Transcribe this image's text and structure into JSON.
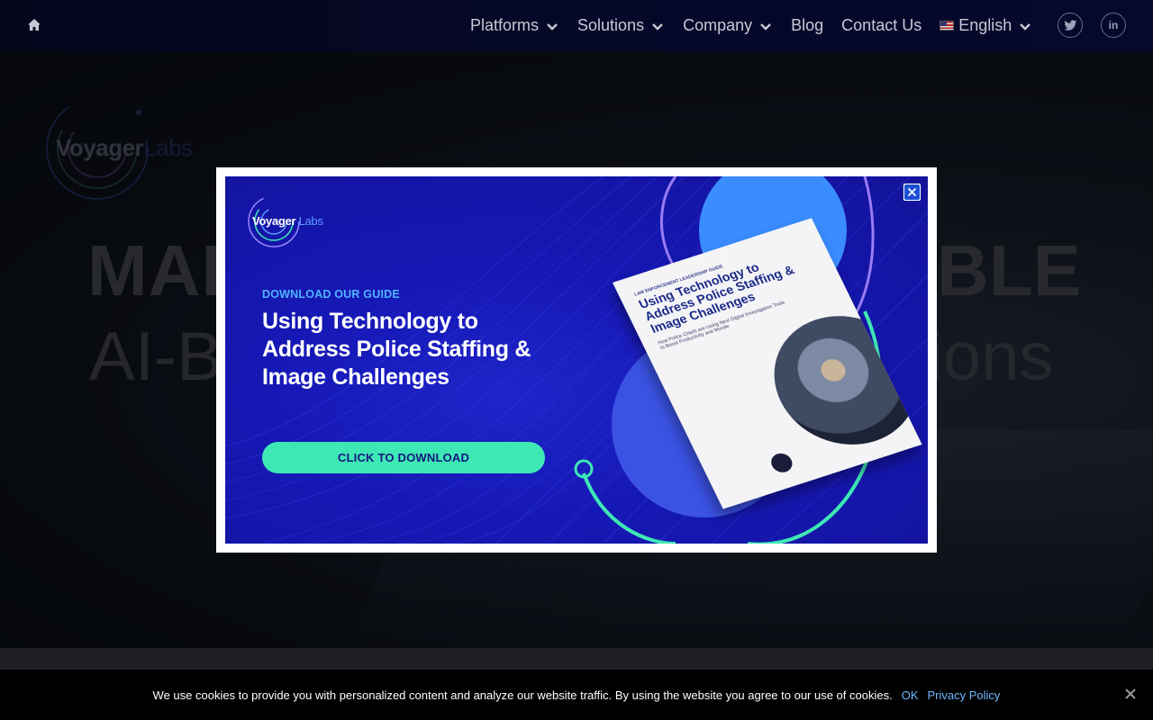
{
  "nav": {
    "items": [
      {
        "label": "Platforms",
        "has_dropdown": true
      },
      {
        "label": "Solutions",
        "has_dropdown": true
      },
      {
        "label": "Company",
        "has_dropdown": true
      },
      {
        "label": "Blog",
        "has_dropdown": false
      },
      {
        "label": "Contact Us",
        "has_dropdown": false
      }
    ],
    "language": {
      "label": "English",
      "flag": "us-flag-icon"
    },
    "social": [
      "twitter-icon",
      "linkedin-icon"
    ],
    "linkedin_text": "in"
  },
  "hero": {
    "logo_word1": "Voyager",
    "logo_word2": "Labs",
    "headline_left": "MAK",
    "headline_right": "BLE",
    "subline_left": "AI-B",
    "subline_right": "ions"
  },
  "modal": {
    "logo_word1": "Voyager",
    "logo_word2": "Labs",
    "kicker": "DOWNLOAD OUR GUIDE",
    "title": "Using Technology to Address Police Staffing & Image Challenges",
    "cta": "CLICK TO DOWNLOAD",
    "book": {
      "kicker": "LAW ENFORCEMENT LEADERSHIP GUIDE",
      "title": "Using Technology to Address Police Staffing & Image Challenges",
      "subtitle": "How Police Chiefs are Using Next Digital Investigation Tools to Boost Productivity and Morale"
    }
  },
  "cookie": {
    "message": "We use cookies to provide you with personalized content and analyze our website traffic. By using the website you agree to our use of cookies.",
    "ok": "OK",
    "policy": "Privacy Policy"
  },
  "colors": {
    "nav_bg": "#05082a",
    "banner_blue": "#1618b5",
    "cta_green": "#3ee8b5",
    "kicker_blue": "#4fb3ff",
    "close_blue": "#1d4fd6",
    "link_blue": "#6fb8ff"
  }
}
